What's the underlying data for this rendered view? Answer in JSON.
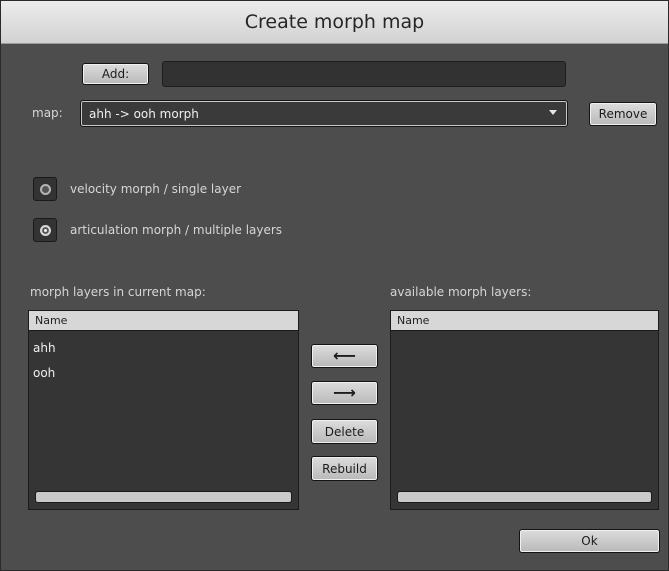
{
  "window": {
    "title": "Create morph map"
  },
  "add": {
    "label": "Add:",
    "value": ""
  },
  "map": {
    "label": "map:",
    "selected": "ahh -> ooh morph",
    "remove_label": "Remove"
  },
  "mode": {
    "options": [
      {
        "label": "velocity morph / single layer",
        "selected": false
      },
      {
        "label": "articulation morph / multiple layers",
        "selected": true
      }
    ]
  },
  "current_layers": {
    "heading": "morph layers in current map:",
    "column": "Name",
    "rows": [
      "ahh",
      "ooh"
    ]
  },
  "available_layers": {
    "heading": "available morph layers:",
    "column": "Name",
    "rows": []
  },
  "actions": {
    "move_left_icon": "arrow-left-icon",
    "move_right_icon": "arrow-right-icon",
    "delete_label": "Delete",
    "rebuild_label": "Rebuild"
  },
  "footer": {
    "ok_label": "Ok"
  }
}
